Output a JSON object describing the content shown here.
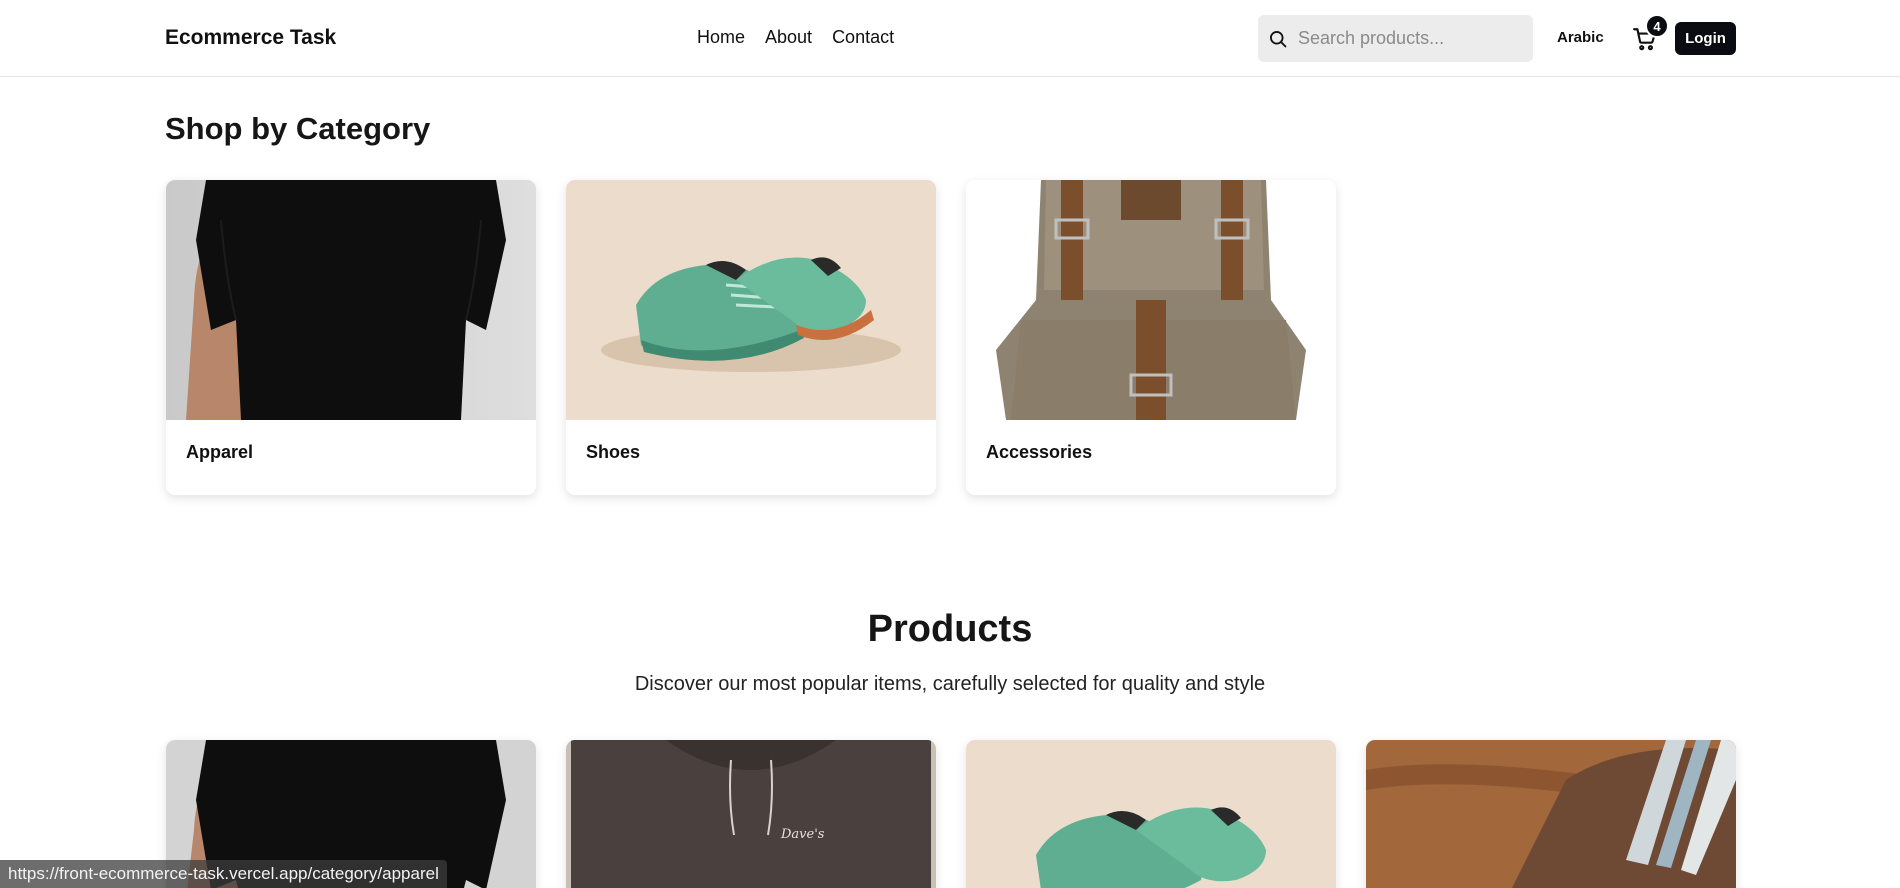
{
  "header": {
    "brand": "Ecommerce Task",
    "nav": [
      {
        "label": "Home"
      },
      {
        "label": "About"
      },
      {
        "label": "Contact"
      }
    ],
    "search": {
      "placeholder": "Search products...",
      "value": ""
    },
    "language_label": "Arabic",
    "cart_count": "4",
    "login_label": "Login"
  },
  "categories": {
    "title": "Shop by Category",
    "items": [
      {
        "label": "Apparel",
        "image": "black-tshirt-image"
      },
      {
        "label": "Shoes",
        "image": "green-sneakers-image"
      },
      {
        "label": "Accessories",
        "image": "canvas-backpack-image"
      }
    ]
  },
  "products": {
    "title": "Products",
    "subtitle": "Discover our most popular items, carefully selected for quality and style",
    "items": [
      {
        "image": "black-tshirt-image"
      },
      {
        "image": "brown-hoodie-image"
      },
      {
        "image": "green-sneakers-image"
      },
      {
        "image": "leather-wallet-image"
      }
    ]
  },
  "status_bar": {
    "url": "https://front-ecommerce-task.vercel.app/category/apparel"
  },
  "colors": {
    "accent": "#0b0b12",
    "search_bg": "#ececec"
  }
}
